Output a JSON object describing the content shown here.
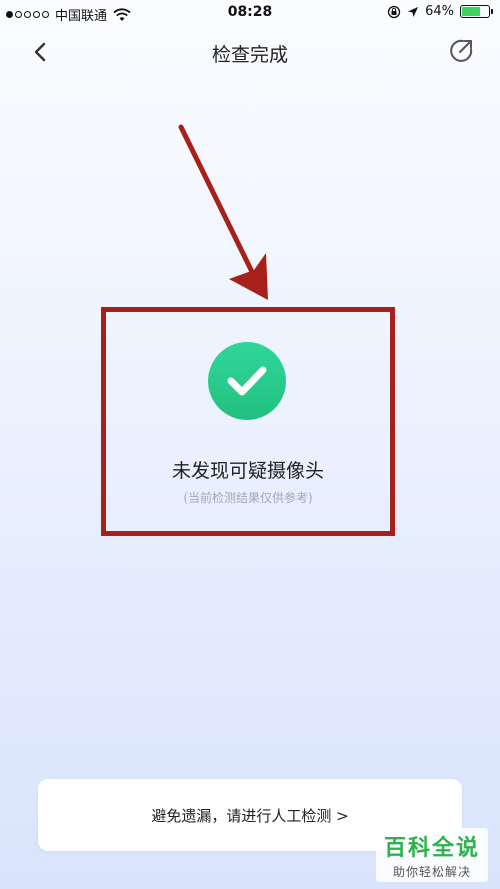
{
  "status_bar": {
    "carrier": "中国联通",
    "time": "08:28",
    "battery_percent": "64%",
    "battery_level": 0.64
  },
  "nav": {
    "title": "检查完成",
    "back_icon": "chevron-left-icon",
    "share_icon": "share-icon"
  },
  "result": {
    "icon": "check-icon",
    "title": "未发现可疑摄像头",
    "subtitle": "(当前检测结果仅供参考)"
  },
  "bottom": {
    "label": "避免遗漏，请进行人工检测 >"
  },
  "watermark": {
    "title": "百科全说",
    "subtitle": "助你轻松解决"
  },
  "colors": {
    "annotation": "#a8201a",
    "check_green": "#22c07f",
    "watermark_green": "#2bb24c"
  }
}
